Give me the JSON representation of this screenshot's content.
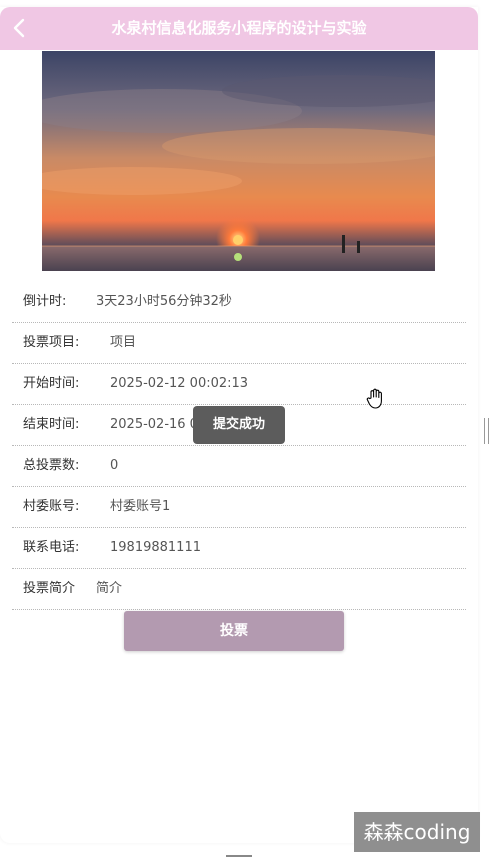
{
  "header": {
    "title": "水泉村信息化服务小程序的设计与实验",
    "back_icon": "chevron-left-icon"
  },
  "info_rows": [
    {
      "label": "倒计时:",
      "value": "3天23小时56分钟32秒"
    },
    {
      "label": "投票项目:",
      "value": "项目"
    },
    {
      "label": "开始时间:",
      "value": "2025-02-12 00:02:13"
    },
    {
      "label": "结束时间:",
      "value": "2025-02-16 00:0"
    },
    {
      "label": "总投票数:",
      "value": "0"
    },
    {
      "label": "村委账号:",
      "value": "村委账号1"
    },
    {
      "label": "联系电话:",
      "value": "19819881111"
    },
    {
      "label": "投票简介",
      "value": "简介"
    }
  ],
  "vote_button": {
    "label": "投票"
  },
  "toast": {
    "text": "提交成功"
  },
  "watermark": {
    "text": "森森coding"
  },
  "colors": {
    "header_bg": "#f0c7e4",
    "vote_button_bg": "#b39ab0",
    "toast_bg": "#5c5c5c"
  }
}
